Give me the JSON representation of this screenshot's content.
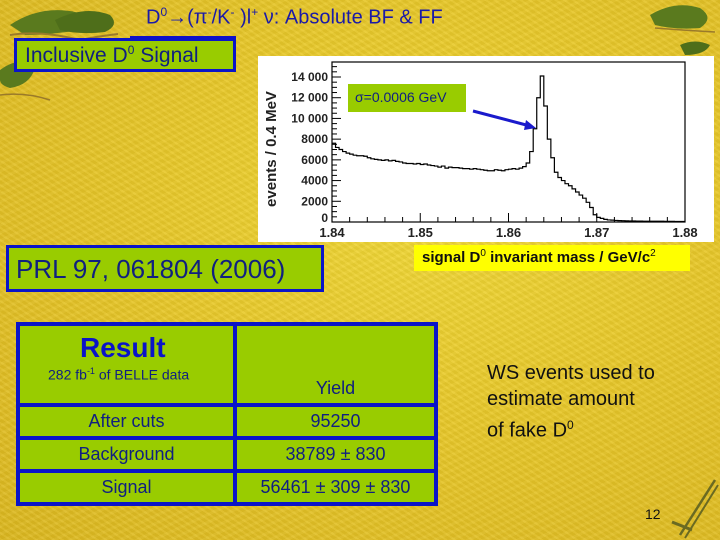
{
  "slide": {
    "title": {
      "pre": "D",
      "sup1": "0",
      "arrow": "→(π",
      "sup2": "-",
      "mid": "/K",
      "sup3": "-",
      "mid2": " )l",
      "sup4": "+",
      "post": " ν: Absolute BF & FF"
    },
    "inclusive_label": {
      "pre": "Inclusive D",
      "sup": "0",
      "post": " Signal"
    },
    "reference_label": "PRL 97, 061804 (2006)",
    "sigma_label": "σ=0.0006 GeV",
    "xaxis_label": {
      "pre": "signal D",
      "sup1": "0",
      "mid": " invariant mass / GeV/c",
      "sup2": "2"
    },
    "ws_note": {
      "line1": "WS events used to",
      "line2": "estimate amount",
      "line3_pre": "of fake D",
      "line3_sup": "0"
    },
    "page_number": "12",
    "colors": {
      "title_blue": "#1a1aa8",
      "box_green": "#99cc00",
      "box_border": "#0a14c8",
      "highlight_yellow": "#ffff00",
      "arrow_blue": "#1a1acc"
    }
  },
  "result_table": {
    "title": "Result",
    "subtitle": {
      "pre": "282 fb",
      "sup": "-1",
      "post": " of BELLE data"
    },
    "column_header": "Yield",
    "rows": [
      {
        "label": "After cuts",
        "value": "95250"
      },
      {
        "label": "Background",
        "value": "38789 ± 830"
      },
      {
        "label": "Signal",
        "value": "56461 ± 309 ± 830"
      }
    ]
  },
  "chart_data": {
    "type": "histogram",
    "title": "",
    "xlabel": "signal D0 invariant mass / GeV/c2",
    "ylabel": "events / 0.4 MeV",
    "xlim": [
      1.84,
      1.88
    ],
    "ylim": [
      0,
      15500
    ],
    "bin_width": 0.0004,
    "x_ticks": [
      "1.84",
      "1.85",
      "1.86",
      "1.87",
      "1.88"
    ],
    "x_tick_values": [
      1.84,
      1.85,
      1.86,
      1.87,
      1.88
    ],
    "y_ticks": [
      "0",
      "2000",
      "4000",
      "6000",
      "8000",
      "10 000",
      "12 000",
      "14 000"
    ],
    "y_tick_values": [
      0,
      2000,
      4000,
      6000,
      8000,
      10000,
      12000,
      14000
    ],
    "annotation": "σ=0.0006 GeV",
    "values": [
      7600,
      7200,
      7000,
      6800,
      6650,
      6550,
      6450,
      6400,
      6400,
      6350,
      6200,
      6100,
      6050,
      6000,
      5950,
      6000,
      5900,
      5950,
      5850,
      5800,
      5700,
      5650,
      5650,
      5600,
      5650,
      5550,
      5600,
      5500,
      5450,
      5400,
      5300,
      5400,
      5200,
      5300,
      5250,
      5250,
      5200,
      5150,
      5150,
      5100,
      5150,
      5100,
      5050,
      5000,
      4950,
      4950,
      5050,
      5000,
      4950,
      5050,
      5100,
      5150,
      5100,
      5200,
      5350,
      5700,
      6800,
      9000,
      12000,
      14100,
      11200,
      8000,
      6200,
      4800,
      4300,
      4000,
      3700,
      3500,
      3200,
      2900,
      2600,
      2300,
      1900,
      1400,
      700,
      450,
      350,
      250,
      200,
      180,
      150,
      130,
      120,
      110,
      100,
      100,
      90,
      90,
      80,
      80,
      80,
      70,
      70,
      70,
      60,
      60,
      60,
      50,
      50,
      50
    ]
  }
}
